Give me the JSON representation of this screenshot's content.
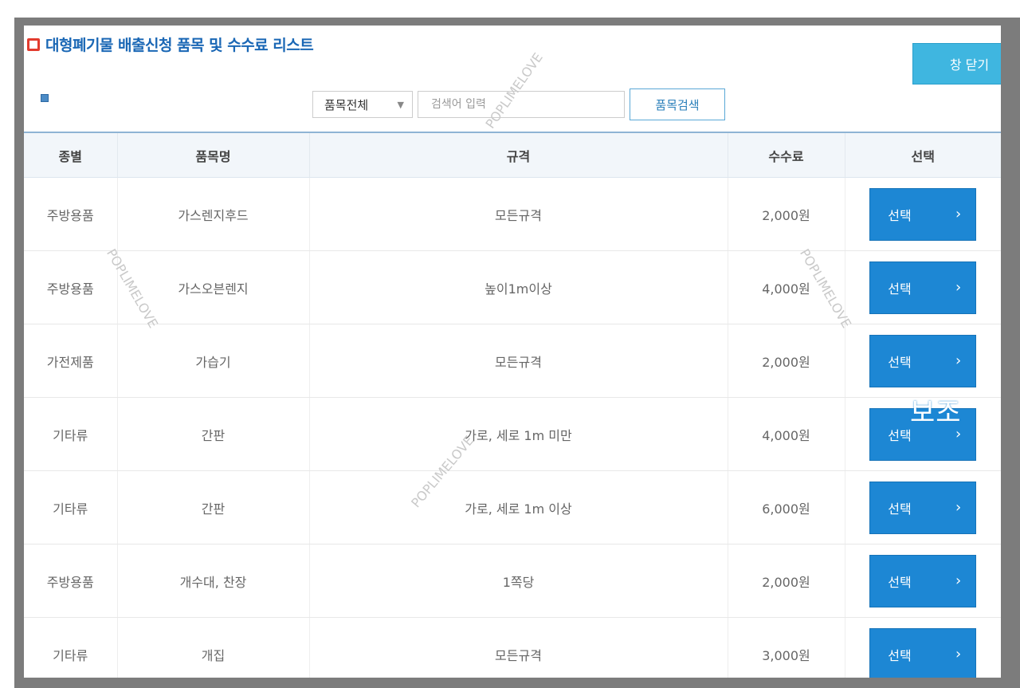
{
  "title": "대형폐기물 배출신청 품목 및 수수료 리스트",
  "close_label": "창 닫기",
  "search": {
    "category_selected": "품목전체",
    "placeholder": "검색어 입력",
    "button_label": "품목검색"
  },
  "table": {
    "headers": [
      "종별",
      "품목명",
      "규격",
      "수수료",
      "선택"
    ],
    "rows": [
      {
        "type": "주방용품",
        "name": "가스렌지후드",
        "spec": "모든규격",
        "fee": "2,000원",
        "select": "선택"
      },
      {
        "type": "주방용품",
        "name": "가스오븐렌지",
        "spec": "높이1m이상",
        "fee": "4,000원",
        "select": "선택"
      },
      {
        "type": "가전제품",
        "name": "가습기",
        "spec": "모든규격",
        "fee": "2,000원",
        "select": "선택"
      },
      {
        "type": "기타류",
        "name": "간판",
        "spec": "가로, 세로 1m 미만",
        "fee": "4,000원",
        "select": "선택"
      },
      {
        "type": "기타류",
        "name": "간판",
        "spec": "가로, 세로 1m 이상",
        "fee": "6,000원",
        "select": "선택"
      },
      {
        "type": "주방용품",
        "name": "개수대, 찬장",
        "spec": "1쪽당",
        "fee": "2,000원",
        "select": "선택"
      },
      {
        "type": "기타류",
        "name": "개집",
        "spec": "모든규격",
        "fee": "3,000원",
        "select": "선택"
      }
    ]
  },
  "overlay_text": "보조",
  "watermark": "POPLIMELOVE",
  "colors": {
    "title": "#1a67b5",
    "close_button": "#3fb6e0",
    "select_button": "#1d87d4",
    "frame": "#7c7c7c"
  }
}
